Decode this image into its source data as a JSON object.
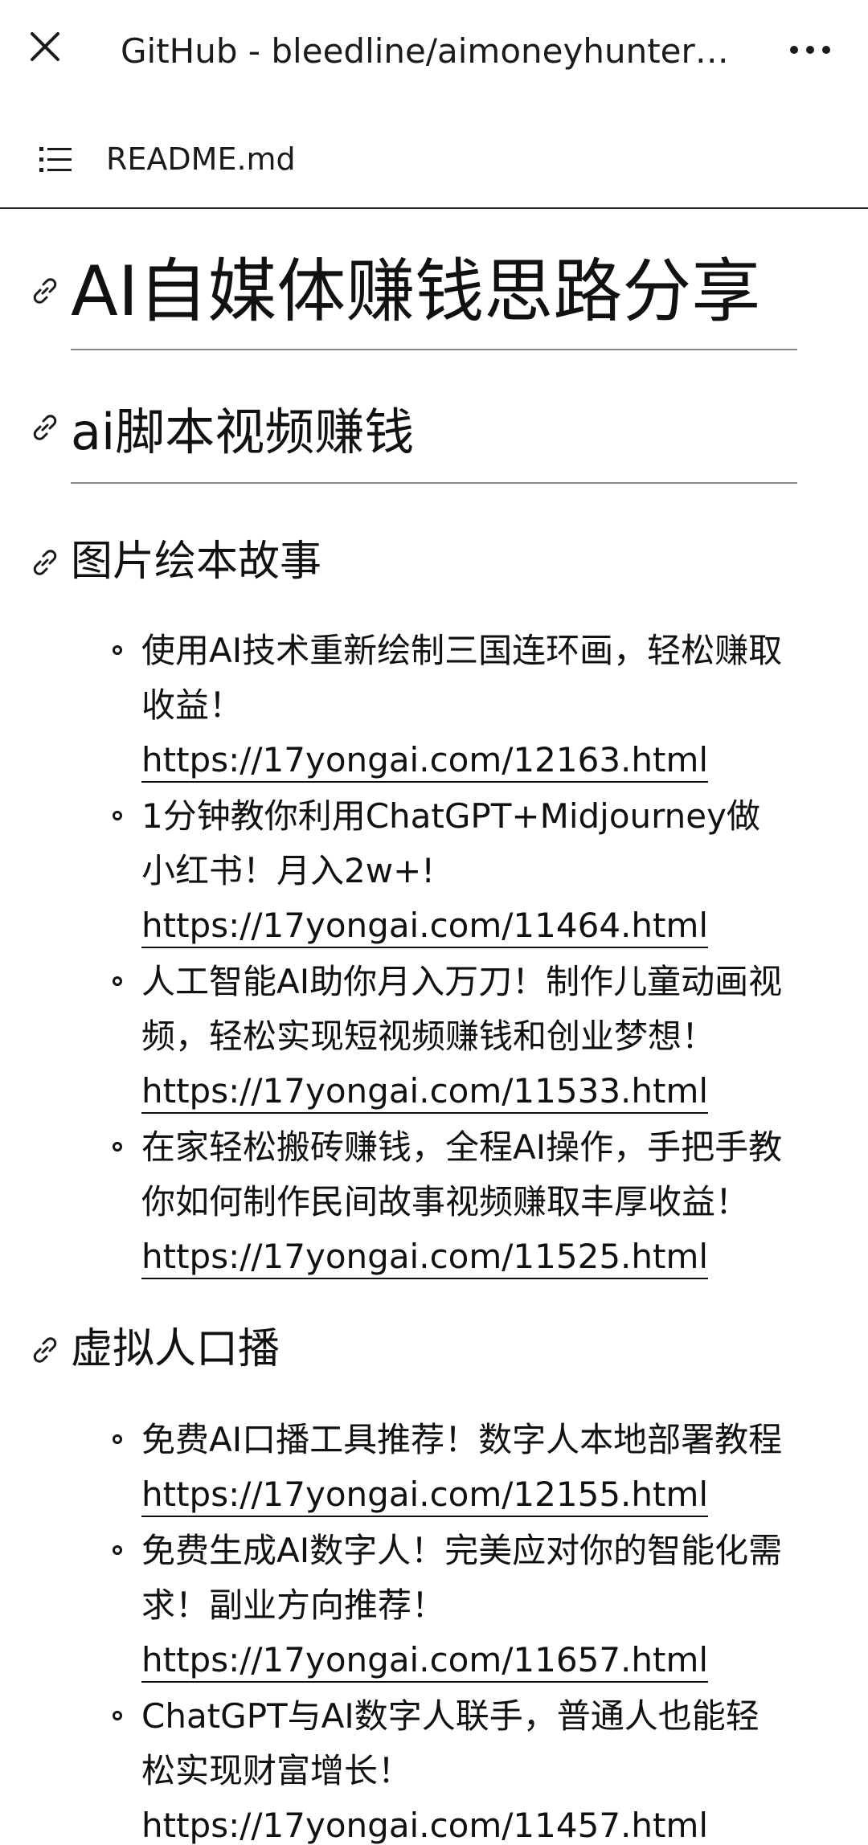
{
  "topbar": {
    "title": "GitHub - bleedline/aimoneyhunter…"
  },
  "filebar": {
    "filename": "README.md"
  },
  "content": {
    "h1": "AI自媒体赚钱思路分享",
    "h2": "ai脚本视频赚钱",
    "sections": [
      {
        "heading": "图片绘本故事",
        "items": [
          {
            "text": "使用AI技术重新绘制三国连环画，轻松赚取收益！",
            "link": "https://17yongai.com/12163.html"
          },
          {
            "text": "1分钟教你利用ChatGPT+Midjourney做小红书！月入2w+!",
            "link": "https://17yongai.com/11464.html"
          },
          {
            "text": "人工智能AI助你月入万刀！制作儿童动画视频，轻松实现短视频赚钱和创业梦想！",
            "link": "https://17yongai.com/11533.html"
          },
          {
            "text": "在家轻松搬砖赚钱，全程AI操作，手把手教你如何制作民间故事视频赚取丰厚收益！",
            "link": "https://17yongai.com/11525.html"
          }
        ]
      },
      {
        "heading": "虚拟人口播",
        "items": [
          {
            "text": "免费AI口播工具推荐！数字人本地部署教程",
            "link": "https://17yongai.com/12155.html"
          },
          {
            "text": "免费生成AI数字人！完美应对你的智能化需求！副业方向推荐！",
            "link": "https://17yongai.com/11657.html"
          },
          {
            "text": "ChatGPT与AI数字人联手，普通人也能轻松实现财富增长！",
            "link": "https://17yongai.com/11457.html"
          }
        ]
      }
    ]
  }
}
